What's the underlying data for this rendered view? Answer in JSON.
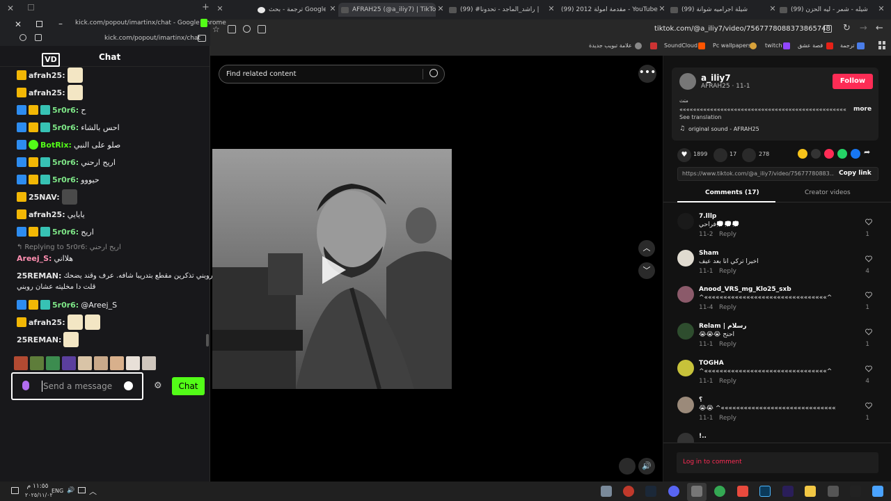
{
  "browser_tabs": [
    {
      "title": "ترجمة - بحث Google"
    },
    {
      "title": "AFRAH25 (@a_iliy7) | TikTok"
    },
    {
      "title": "(99) #راشد_الماجد - تحدونا |"
    },
    {
      "title": "(99) مقدمة امولة 2012 - YouTube"
    },
    {
      "title": "(99) شيلة اجراميه شوانة"
    },
    {
      "title": "(99) شيله - شمر - ليه الحزن"
    }
  ],
  "popup": {
    "window_title": "kick.com/popout/imartinx/chat - Google Chrome",
    "url": "kick.com/popout/imartinx/chat",
    "chat_header": "Chat",
    "messages": [
      {
        "user": "afrah25:",
        "color": "#e6e6e6",
        "text": ""
      },
      {
        "user": "afrah25:",
        "color": "#e6e6e6",
        "text": ""
      },
      {
        "user": "5r0r6:",
        "color": "#7ee787",
        "text": "ح"
      },
      {
        "user": "5r0r6:",
        "color": "#7ee787",
        "text": "احس بالشاء"
      },
      {
        "user": "BotRix:",
        "color": "#53fc18",
        "text": "صلو على النبي"
      },
      {
        "user": "5r0r6:",
        "color": "#7ee787",
        "text": "اريح ارحني"
      },
      {
        "user": "5r0r6:",
        "color": "#7ee787",
        "text": "حيووو"
      },
      {
        "user": "25NAV:",
        "color": "#e6e6e6",
        "text": ""
      },
      {
        "user": "afrah25:",
        "color": "#e6e6e6",
        "text": "يايايي"
      },
      {
        "user": "5r0r6:",
        "color": "#7ee787",
        "text": "اريح"
      }
    ],
    "reply_to": "Replying to 5r0r6:",
    "reply_quote": "اريح ارحني",
    "reply_user": "Areej_S:",
    "reply_text": "هلااني",
    "long_msg_user": "25REMAN:",
    "long_msg_line1": "روبني تذكرين مقطع بتدريبا شافه. عرف وقند يضحك",
    "long_msg_line2": "قلت دا مخليته عشان روبني",
    "mention_user": "5r0r6:",
    "mention_text": "@Areej_S",
    "afrah_last": "afrah25:",
    "reman_last": "25REMAN:",
    "input_placeholder": "Send a message",
    "send_label": "Chat"
  },
  "page": {
    "address": "tiktok.com/@a_iliy7/video/7567778088373865748",
    "bookmarks": [
      "علامة تبويب جديدة",
      "SoundCloud",
      "Pc wallpapers",
      "twitch",
      "قصة عشق",
      "ترجمة"
    ],
    "search_placeholder": "Find related content",
    "author": "a_iliy7",
    "author_sub": "AFRAH25 · 11-1",
    "follow_label": "Follow",
    "caption_lead": "متث",
    "caption": "«««««««««««««««««««««««««««««««««««««««««««««««««",
    "more_label": "more",
    "see_translation": "See translation",
    "sound": "original sound - AFRAH25",
    "likes": "1899",
    "comments_count": "17",
    "saves": "278",
    "share_url": "https://www.tiktok.com/@a_iliy7/video/75677780883...",
    "copy_link": "Copy link",
    "tab_comments": "Comments (17)",
    "tab_creator": "Creator videos",
    "login_prompt": "Log in to comment",
    "comments": [
      {
        "name": "7.lllp",
        "text": "فراحي💭💭💭",
        "date": "11-2",
        "reply": "Reply",
        "likes": "1"
      },
      {
        "name": "Sham",
        "text": "اخيرا تركي انا بعد عيف",
        "date": "11-1",
        "reply": "Reply",
        "likes": "4"
      },
      {
        "name": "Anood_VRS_mg_Klo25_sxb",
        "text": "^««««««««««««««««««««««««««««««««^",
        "date": "11-4",
        "reply": "Reply",
        "likes": "1"
      },
      {
        "name": "Relam | رسلام",
        "text": "😭😭😭 احنح",
        "date": "11-1",
        "reply": "Reply",
        "likes": "1"
      },
      {
        "name": "TOGHA",
        "text": "^««««««««««««««««««««««««««««««««^",
        "date": "11-1",
        "reply": "Reply",
        "likes": "4"
      },
      {
        "name": "؟",
        "text": "😭😭 ^««««««««««««««««««««««««««««««",
        "date": "11-1",
        "reply": "Reply",
        "likes": "1"
      },
      {
        "name": "!..",
        "text": "",
        "date": "",
        "reply": "",
        "likes": ""
      }
    ]
  },
  "taskbar": {
    "time": "١١:٥٥ م",
    "date": "٢٠٢٥/١١/٠٢",
    "lang": "ENG"
  },
  "colors": {
    "kick_green": "#53fc18",
    "tiktok_red": "#fe2c55",
    "panel_dark": "#121212"
  }
}
